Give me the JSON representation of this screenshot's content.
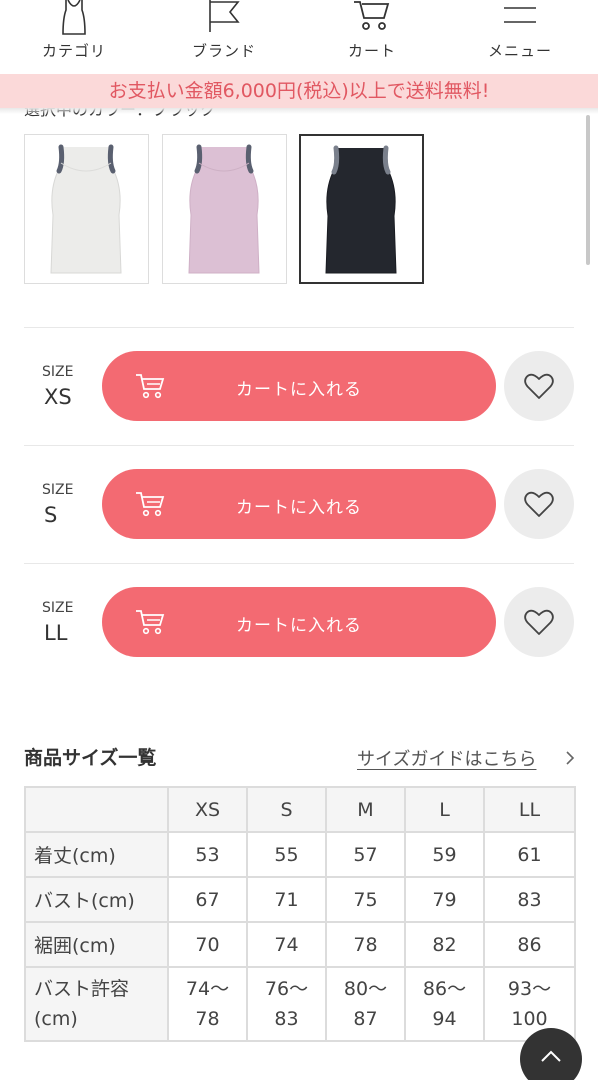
{
  "nav": {
    "category_label": "カテゴリ",
    "brand_label": "ブランド",
    "cart_label": "カート",
    "menu_label": "メニュー"
  },
  "banner": {
    "text": "お支払い金額6,000円(税込)以上で送料無料!"
  },
  "colors_section": {
    "partial_label": "選択中のカラー：ブラック"
  },
  "swatches": [
    {
      "color": "#ececea",
      "name": "white"
    },
    {
      "color": "#dcc0d4",
      "name": "pink"
    },
    {
      "color": "#24272e",
      "name": "black",
      "selected": true
    }
  ],
  "sizes": [
    {
      "caption": "SIZE",
      "size": "XS",
      "cart_label": "カートに入れる"
    },
    {
      "caption": "SIZE",
      "size": "S",
      "cart_label": "カートに入れる"
    },
    {
      "caption": "SIZE",
      "size": "LL",
      "cart_label": "カートに入れる"
    }
  ],
  "size_table": {
    "title": "商品サイズ一覧",
    "guide_link": "サイズガイドはこちら",
    "columns": [
      "XS",
      "S",
      "M",
      "L",
      "LL"
    ],
    "rows": [
      {
        "label": "着丈(cm)",
        "values": [
          "53",
          "55",
          "57",
          "59",
          "61"
        ]
      },
      {
        "label": "バスト(cm)",
        "values": [
          "67",
          "71",
          "75",
          "79",
          "83"
        ]
      },
      {
        "label": "裾囲(cm)",
        "values": [
          "70",
          "74",
          "78",
          "82",
          "86"
        ]
      },
      {
        "label_line1": "バスト許容",
        "label_line2": "(cm)",
        "values": [
          [
            "74〜",
            "78"
          ],
          [
            "76〜",
            "83"
          ],
          [
            "80〜",
            "87"
          ],
          [
            "86〜",
            "94"
          ],
          [
            "93〜",
            "100"
          ]
        ]
      }
    ]
  },
  "theme": {
    "accent": "#f36a72",
    "banner_bg": "#fbd9d9",
    "banner_text": "#e15862"
  }
}
